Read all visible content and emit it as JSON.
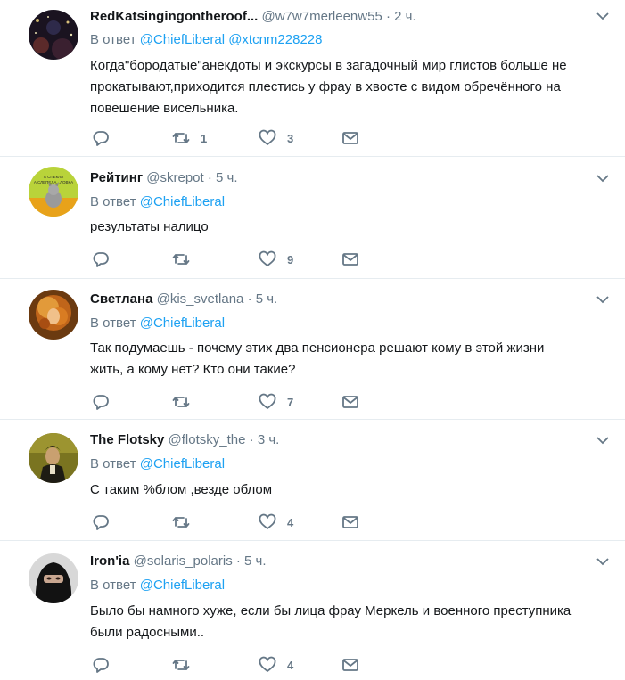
{
  "reply_prefix": "В ответ",
  "tweets": [
    {
      "name": "RedKatsingingontheroof...",
      "handle": "@w7w7merleenw55",
      "separator": "·",
      "time": "2 ч.",
      "mentions": "@ChiefLiberal @xtcnm228228",
      "text_lines": [
        "Когда\"бородатые\"анекдоты и экскурсы в загадочный мир глистов больше не",
        "прокатывают,приходится плестись у фрау в хвосте с видом обречённого на",
        "повешение висельника."
      ],
      "retweets": "1",
      "likes": "3"
    },
    {
      "name": "Рейтинг",
      "handle": "@skrepot",
      "separator": "·",
      "time": "5 ч.",
      "mentions": "@ChiefLiberal",
      "text_lines": [
        "результаты налицо"
      ],
      "retweets": "",
      "likes": "9"
    },
    {
      "name": "Светлана",
      "handle": "@kis_svetlana",
      "separator": "·",
      "time": "5 ч.",
      "mentions": "@ChiefLiberal",
      "text_lines": [
        "Так подумаешь - почему этих два пенсионера решают кому в этой жизни",
        "жить, а кому нет? Кто они такие?"
      ],
      "retweets": "",
      "likes": "7"
    },
    {
      "name": "The Flotsky",
      "handle": "@flotsky_the",
      "separator": "·",
      "time": "3 ч.",
      "mentions": "@ChiefLiberal",
      "text_lines": [
        "С таким %блом ,везде облом"
      ],
      "retweets": "",
      "likes": "4"
    },
    {
      "name": "Iron'ia",
      "handle": "@solaris_polaris",
      "separator": "·",
      "time": "5 ч.",
      "mentions": "@ChiefLiberal",
      "text_lines": [
        "Было бы намного хуже, если бы лица фрау Меркель и военного преступника",
        "были радосными.."
      ],
      "retweets": "",
      "likes": "4"
    }
  ],
  "avatar2_text": [
    "А СПЕКЛА",
    "А СЛЕПЕЛА...ЛОВКА"
  ],
  "icons": {
    "reply": "reply-icon",
    "retweet": "retweet-icon",
    "like": "heart-icon",
    "dm": "mail-icon",
    "menu": "chevron-down-icon"
  },
  "colors": {
    "name": "#14171a",
    "meta": "#657786",
    "mention": "#1da1f2",
    "divider": "#e6ecf0"
  }
}
